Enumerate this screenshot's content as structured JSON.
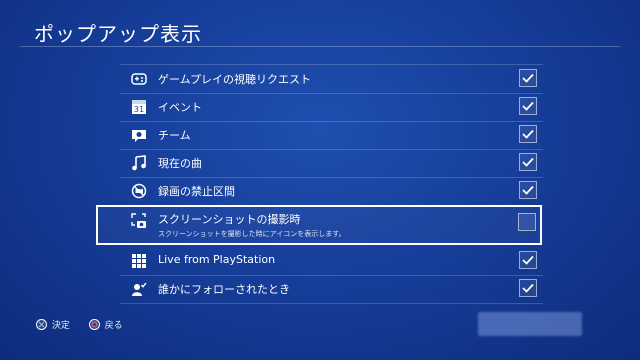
{
  "header": {
    "title": "ポップアップ表示"
  },
  "items": [
    {
      "label": "ゲームプレイの視聴リクエスト",
      "icon": "controller-icon",
      "checked": true
    },
    {
      "label": "イベント",
      "icon": "calendar-icon",
      "checked": true
    },
    {
      "label": "チーム",
      "icon": "team-icon",
      "checked": true
    },
    {
      "label": "現在の曲",
      "icon": "music-note-icon",
      "checked": true
    },
    {
      "label": "録画の禁止区間",
      "icon": "no-recording-icon",
      "checked": true
    },
    {
      "label": "スクリーンショットの撮影時",
      "description": "スクリーンショットを撮影した時にアイコンを表示します。",
      "icon": "screenshot-camera-icon",
      "checked": false,
      "selected": true
    },
    {
      "label": "Live from PlayStation",
      "icon": "live-grid-icon",
      "checked": true
    },
    {
      "label": "誰かにフォローされたとき",
      "icon": "follow-user-icon",
      "checked": true
    }
  ],
  "footer": {
    "confirm_label": "決定",
    "back_label": "戻る"
  },
  "colors": {
    "background": "#163e9a",
    "text": "#ffffff"
  }
}
